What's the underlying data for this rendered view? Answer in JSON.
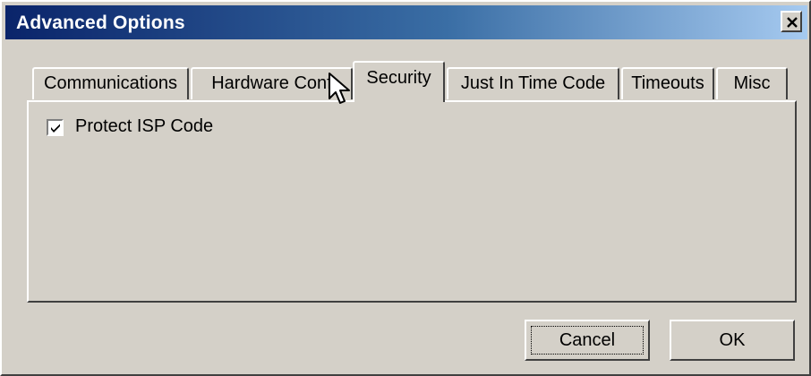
{
  "window": {
    "title": "Advanced Options",
    "title_gradient_start": "#0a246a",
    "title_gradient_end": "#a6caf0",
    "face_color": "#d4d0c8",
    "close_icon": "close-x-icon"
  },
  "tabs": [
    {
      "label": "Communications",
      "active": false
    },
    {
      "label": "Hardware Conf",
      "active": false
    },
    {
      "label": "Security",
      "active": true
    },
    {
      "label": "Just In Time Code",
      "active": false
    },
    {
      "label": "Timeouts",
      "active": false
    },
    {
      "label": "Misc",
      "active": false
    }
  ],
  "security": {
    "protect_isp_code_label": "Protect ISP Code",
    "protect_isp_code_checked": true
  },
  "buttons": {
    "cancel_label": "Cancel",
    "ok_label": "OK"
  },
  "cursor": {
    "icon": "arrow-pointer-icon"
  }
}
